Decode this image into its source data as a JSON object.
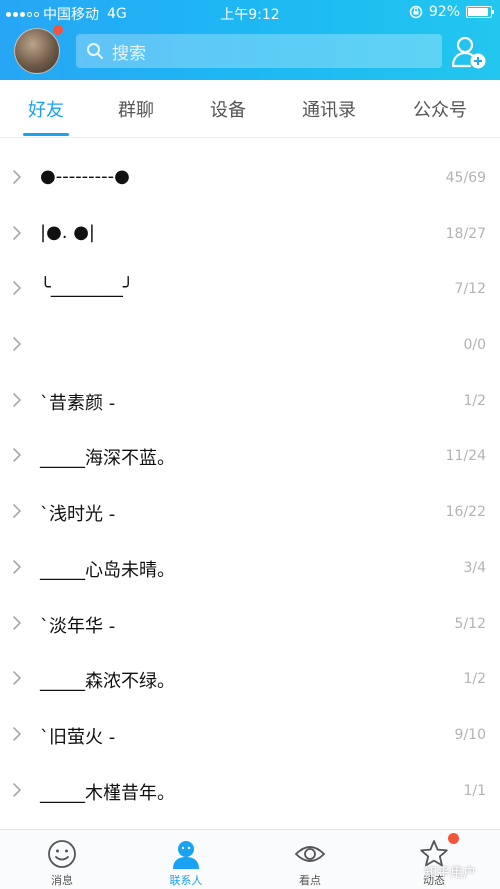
{
  "status_bar": {
    "carrier": "中国移动",
    "network": "4G",
    "time": "上午9:12",
    "battery": "92%",
    "battery_level": 0.92
  },
  "header": {
    "search_placeholder": "搜索"
  },
  "tabs": [
    {
      "label": "好友",
      "active": true
    },
    {
      "label": "群聊",
      "active": false
    },
    {
      "label": "设备",
      "active": false
    },
    {
      "label": "通讯录",
      "active": false
    },
    {
      "label": "公众号",
      "active": false
    }
  ],
  "groups": [
    {
      "name": "●---------●",
      "count": "45/69"
    },
    {
      "name": "|●. ●|",
      "count": "18/27"
    },
    {
      "name": "╰________╯",
      "count": "7/12"
    },
    {
      "name": "",
      "count": "0/0"
    },
    {
      "name": "ˋ昔素颜 -",
      "count": "1/2"
    },
    {
      "name": "_____海深不蓝。",
      "count": "11/24"
    },
    {
      "name": "ˋ浅时光 -",
      "count": "16/22"
    },
    {
      "name": "_____心岛未晴。",
      "count": "3/4"
    },
    {
      "name": "ˋ淡年华 -",
      "count": "5/12"
    },
    {
      "name": "_____森浓不绿。",
      "count": "1/2"
    },
    {
      "name": "ˋ旧萤火 -",
      "count": "9/10"
    },
    {
      "name": "_____木槿昔年。",
      "count": "1/1"
    }
  ],
  "bottom_nav": [
    {
      "label": "消息",
      "icon": "smiley-icon",
      "active": false
    },
    {
      "label": "联系人",
      "icon": "person-icon",
      "active": true
    },
    {
      "label": "看点",
      "icon": "eye-icon",
      "active": false
    },
    {
      "label": "动态",
      "icon": "star-icon",
      "active": false
    }
  ],
  "watermark": "知乎用户",
  "colors": {
    "accent": "#18a2f1",
    "header_gradient_start": "#27a6f5",
    "header_gradient_end": "#22c6ee",
    "badge": "#f4543b"
  }
}
